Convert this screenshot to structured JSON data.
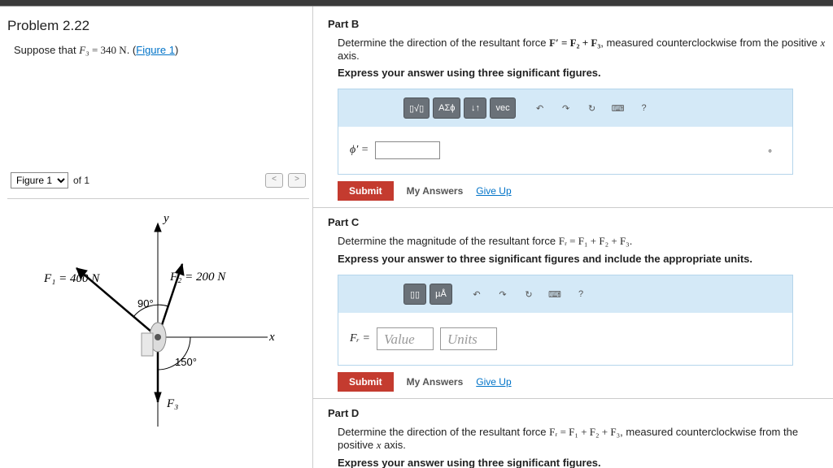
{
  "problem": {
    "title": "Problem 2.22",
    "suppose_pre": "Suppose that ",
    "suppose_var": "F₃",
    "suppose_eq": " = 340  N",
    "suppose_post": ". (",
    "figure_link": "Figure 1",
    "suppose_close": ")"
  },
  "figure_nav": {
    "selected": "Figure 1",
    "of": "of 1",
    "prev": "<",
    "next": ">"
  },
  "figure": {
    "y_label": "y",
    "x_label": "x",
    "f1": "F₁ = 400 N",
    "f2": "F₂ = 200 N",
    "f3": "F₃",
    "angle90": "90°",
    "angle150": "150°"
  },
  "partB": {
    "title": "Part B",
    "desc_pre": "Determine the direction of the resultant force ",
    "desc_eq": "F′ = F₂ + F₃",
    "desc_post": ", measured counterclockwise from the positive ",
    "desc_axis": "x",
    "desc_end": " axis.",
    "instruction": "Express your answer using three significant figures.",
    "var_label": "ϕ′ =",
    "deg_unit": "∘"
  },
  "partC": {
    "title": "Part C",
    "desc_pre": "Determine the magnitude of the resultant force ",
    "desc_eq": "Fᵣ = F₁ + F₂ + F₃",
    "desc_post": ".",
    "instruction": "Express your answer to three significant figures and include the appropriate units.",
    "var_label": "Fᵣ =",
    "value_ph": "Value",
    "units_ph": "Units"
  },
  "partD": {
    "title": "Part D",
    "desc_pre": "Determine the direction of the resultant force ",
    "desc_eq": "Fᵣ = F₁ + F₂ + F₃",
    "desc_post": ", measured counterclockwise from the positive ",
    "desc_axis": "x",
    "desc_end": " axis.",
    "instruction": "Express your answer using three significant figures."
  },
  "toolbar": {
    "template": "▯√▯",
    "greek": "ΑΣϕ",
    "arrows": "↓↑",
    "vec": "vec",
    "undo": "↶",
    "redo": "↷",
    "reset": "↻",
    "keyboard": "⌨",
    "help": "?",
    "units_btn": "▯▯",
    "micro": "µÅ"
  },
  "actions": {
    "submit": "Submit",
    "my_answers": "My Answers",
    "give_up": "Give Up"
  }
}
